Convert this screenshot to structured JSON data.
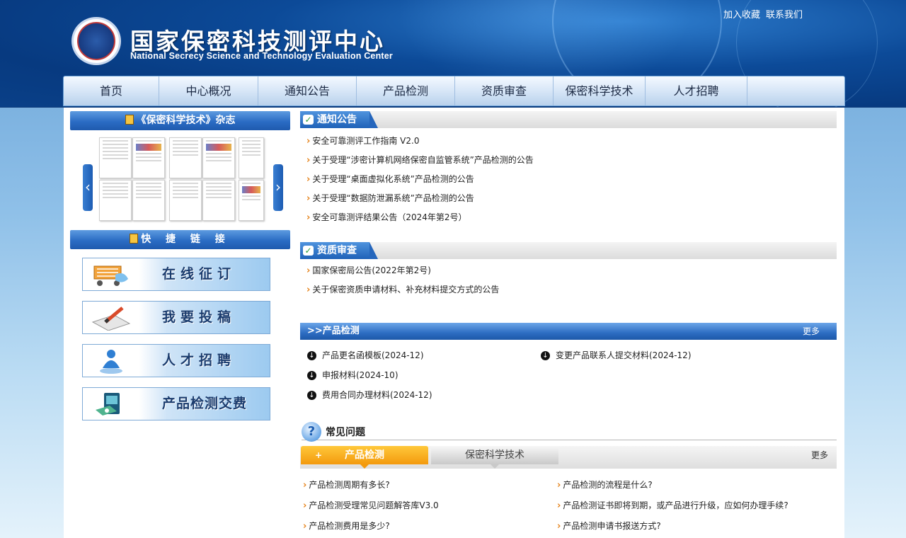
{
  "header": {
    "top_links": [
      "加入收藏",
      "联系我们"
    ],
    "title_cn": "国家保密科技测评中心",
    "title_en": "National Secrecy Science and Technology Evaluation Center"
  },
  "nav": [
    "首页",
    "中心概况",
    "通知公告",
    "产品检测",
    "资质审查",
    "保密科学技术",
    "人才招聘"
  ],
  "left": {
    "magazine_title": "《保密科学技术》杂志",
    "quick_links_title": "快 捷 链 接",
    "quick_links": [
      "在线征订",
      "我要投稿",
      "人才招聘",
      "产品检测交费"
    ]
  },
  "notices": {
    "title": "通知公告",
    "items": [
      "安全可靠测评工作指南 V2.0",
      "关于受理“涉密计算机网络保密自监管系统”产品检测的公告",
      "关于受理“桌面虚拟化系统”产品检测的公告",
      "关于受理“数据防泄漏系统”产品检测的公告",
      "安全可靠测评结果公告（2024年第2号）"
    ]
  },
  "qualification": {
    "title": "资质审查",
    "items": [
      "国家保密局公告(2022年第2号)",
      "关于保密资质申请材料、补充材料提交方式的公告"
    ]
  },
  "product_test": {
    "title": ">>产品检测",
    "more": "更多",
    "items": [
      "产品更名函模板(2024-12)",
      "变更产品联系人提交材料(2024-12)",
      "申报材料(2024-10)",
      "费用合同办理材料(2024-12)"
    ]
  },
  "faq": {
    "title": "常见问题",
    "tabs": [
      "产品检测",
      "保密科学技术"
    ],
    "more": "更多",
    "items": [
      "产品检测周期有多长?",
      "产品检测的流程是什么?",
      "产品检测受理常见问题解答库V3.0",
      "产品检测证书即将到期，或产品进行升级，应如何办理手续?",
      "产品检测费用是多少?",
      "产品检测申请书报送方式?"
    ]
  },
  "colors": {
    "header_blue": "#0c4a98",
    "section_blue": "#2b6cc4",
    "bullet_orange": "#e5831b",
    "faq_tab_orange": "#f39a0e"
  }
}
